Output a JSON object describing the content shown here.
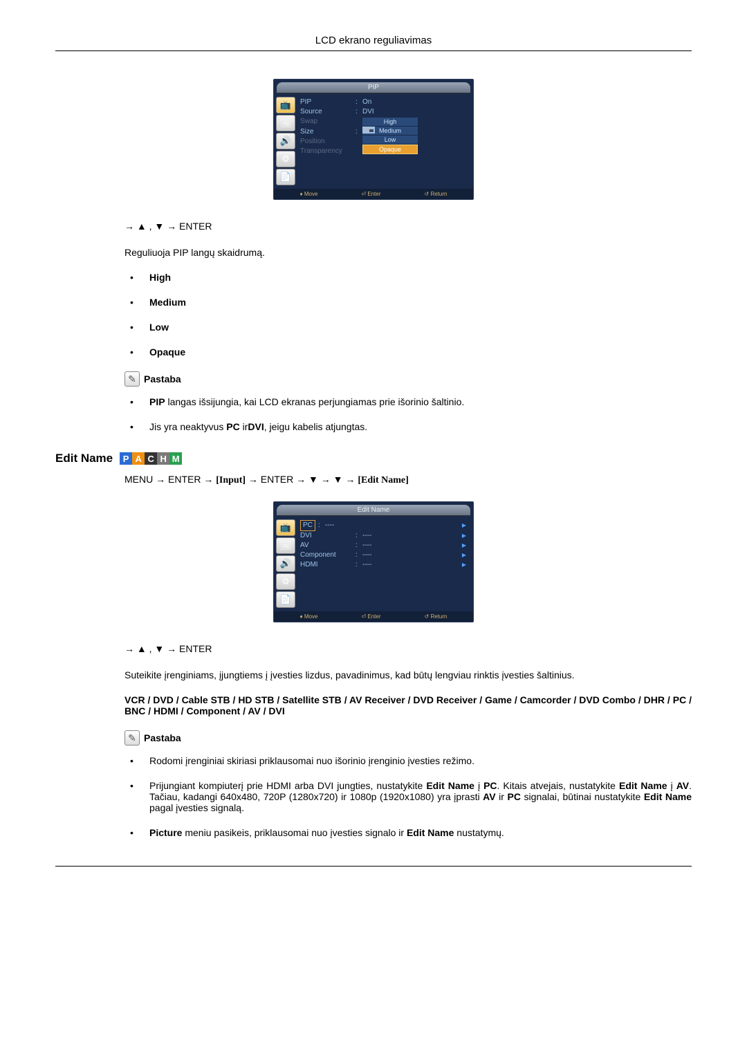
{
  "header": {
    "title": "LCD ekrano reguliavimas"
  },
  "osd_pip": {
    "title": "PIP",
    "rows": {
      "pip": {
        "label": "PIP",
        "value": "On"
      },
      "source": {
        "label": "Source",
        "value": "DVI"
      },
      "swap": {
        "label": "Swap"
      },
      "size": {
        "label": "Size"
      },
      "position": {
        "label": "Position"
      },
      "transparency": {
        "label": "Transparency"
      }
    },
    "submenu": {
      "high": "High",
      "medium": "Medium",
      "low": "Low",
      "opaque": "Opaque"
    },
    "footer": {
      "move": "Move",
      "enter": "Enter",
      "return": "Return"
    }
  },
  "transparency_section": {
    "nav_line": "→ ▲ , ▼ → ENTER",
    "desc": "Reguliuoja PIP langų skaidrumą.",
    "items": {
      "high": "High",
      "medium": "Medium",
      "low": "Low",
      "opaque": "Opaque"
    },
    "note_label": "Pastaba",
    "notes": {
      "n1_pre": "PIP",
      "n1_post": " langas išsijungia, kai LCD ekranas perjungiamas prie išorinio šaltinio.",
      "n2_a": "Jis yra neaktyvus ",
      "n2_b": "PC",
      "n2_c": " ir",
      "n2_d": "DVI",
      "n2_e": ", jeigu kabelis atjungtas."
    }
  },
  "edit_name_section": {
    "title": "Edit Name",
    "modes": {
      "P": "P",
      "A": "A",
      "C": "C",
      "H": "H",
      "M": "M"
    },
    "nav_line_a": "MENU → ENTER → ",
    "nav_input": "[Input]",
    "nav_line_b": " → ENTER → ▼ → ▼ → ",
    "nav_editname": "[Edit Name]"
  },
  "osd_editname": {
    "title": "Edit Name",
    "rows": {
      "pc": {
        "label": "PC",
        "value": "----"
      },
      "dvi": {
        "label": "DVI",
        "value": "----"
      },
      "av": {
        "label": "AV",
        "value": "----"
      },
      "component": {
        "label": "Component",
        "value": "----"
      },
      "hdmi": {
        "label": "HDMI",
        "value": "----"
      }
    },
    "footer": {
      "move": "Move",
      "enter": "Enter",
      "return": "Return"
    }
  },
  "edit_name_body": {
    "nav_line": "→ ▲ , ▼ → ENTER",
    "desc": "Suteikite įrenginiams, įjungtiems į įvesties lizdus, pavadinimus, kad būtų lengviau rinktis įvesties šaltinius.",
    "options_line": "VCR / DVD / Cable STB / HD STB / Satellite STB / AV Receiver / DVD Receiver / Game / Camcorder / DVD Combo / DHR / PC / BNC / HDMI / Component / AV / DVI",
    "note_label": "Pastaba",
    "notes": {
      "n1": "Rodomi įrenginiai skiriasi priklausomai nuo išorinio įrenginio įvesties režimo.",
      "n2_a": "Prijungiant kompiuterį prie HDMI arba DVI jungties, nustatykite ",
      "n2_b": "Edit Name",
      "n2_c": " į ",
      "n2_d": "PC",
      "n2_e": ". Kitais atvejais, nustatykite ",
      "n2_f": "Edit Name",
      "n2_g": " į ",
      "n2_h": "AV",
      "n2_i": ". Tačiau, kadangi 640x480, 720P (1280x720) ir 1080p (1920x1080) yra įprasti ",
      "n2_j": "AV",
      "n2_k": " ir ",
      "n2_l": "PC",
      "n2_m": " signalai, būtinai nustatykite ",
      "n2_n": "Edit Name",
      "n2_o": " pagal įvesties signalą.",
      "n3_a": "Picture",
      "n3_b": " meniu pasikeis, priklausomai nuo įvesties signalo ir ",
      "n3_c": "Edit Name",
      "n3_d": " nustatymų."
    }
  }
}
